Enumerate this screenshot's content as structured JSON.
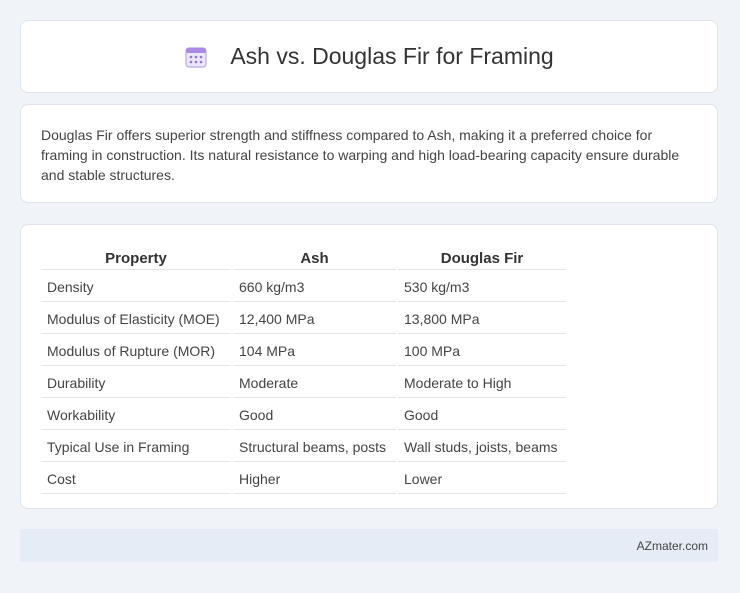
{
  "header": {
    "icon": "calendar-icon",
    "title": "Ash vs. Douglas Fir for Framing"
  },
  "description": "Douglas Fir offers superior strength and stiffness compared to Ash, making it a preferred choice for framing in construction. Its natural resistance to warping and high load-bearing capacity ensure durable and stable structures.",
  "table": {
    "headers": [
      "Property",
      "Ash",
      "Douglas Fir"
    ],
    "rows": [
      [
        "Density",
        "660 kg/m3",
        "530 kg/m3"
      ],
      [
        "Modulus of Elasticity (MOE)",
        "12,400 MPa",
        "13,800 MPa"
      ],
      [
        "Modulus of Rupture (MOR)",
        "104 MPa",
        "100 MPa"
      ],
      [
        "Durability",
        "Moderate",
        "Moderate to High"
      ],
      [
        "Workability",
        "Good",
        "Good"
      ],
      [
        "Typical Use in Framing",
        "Structural beams, posts",
        "Wall studs, joists, beams"
      ],
      [
        "Cost",
        "Higher",
        "Lower"
      ]
    ]
  },
  "footer": {
    "brand": "AZmater.com"
  },
  "colors": {
    "background": "#f0f3f8",
    "card": "#ffffff",
    "footer": "#e6ecf6",
    "icon_accent": "#a98be6"
  }
}
